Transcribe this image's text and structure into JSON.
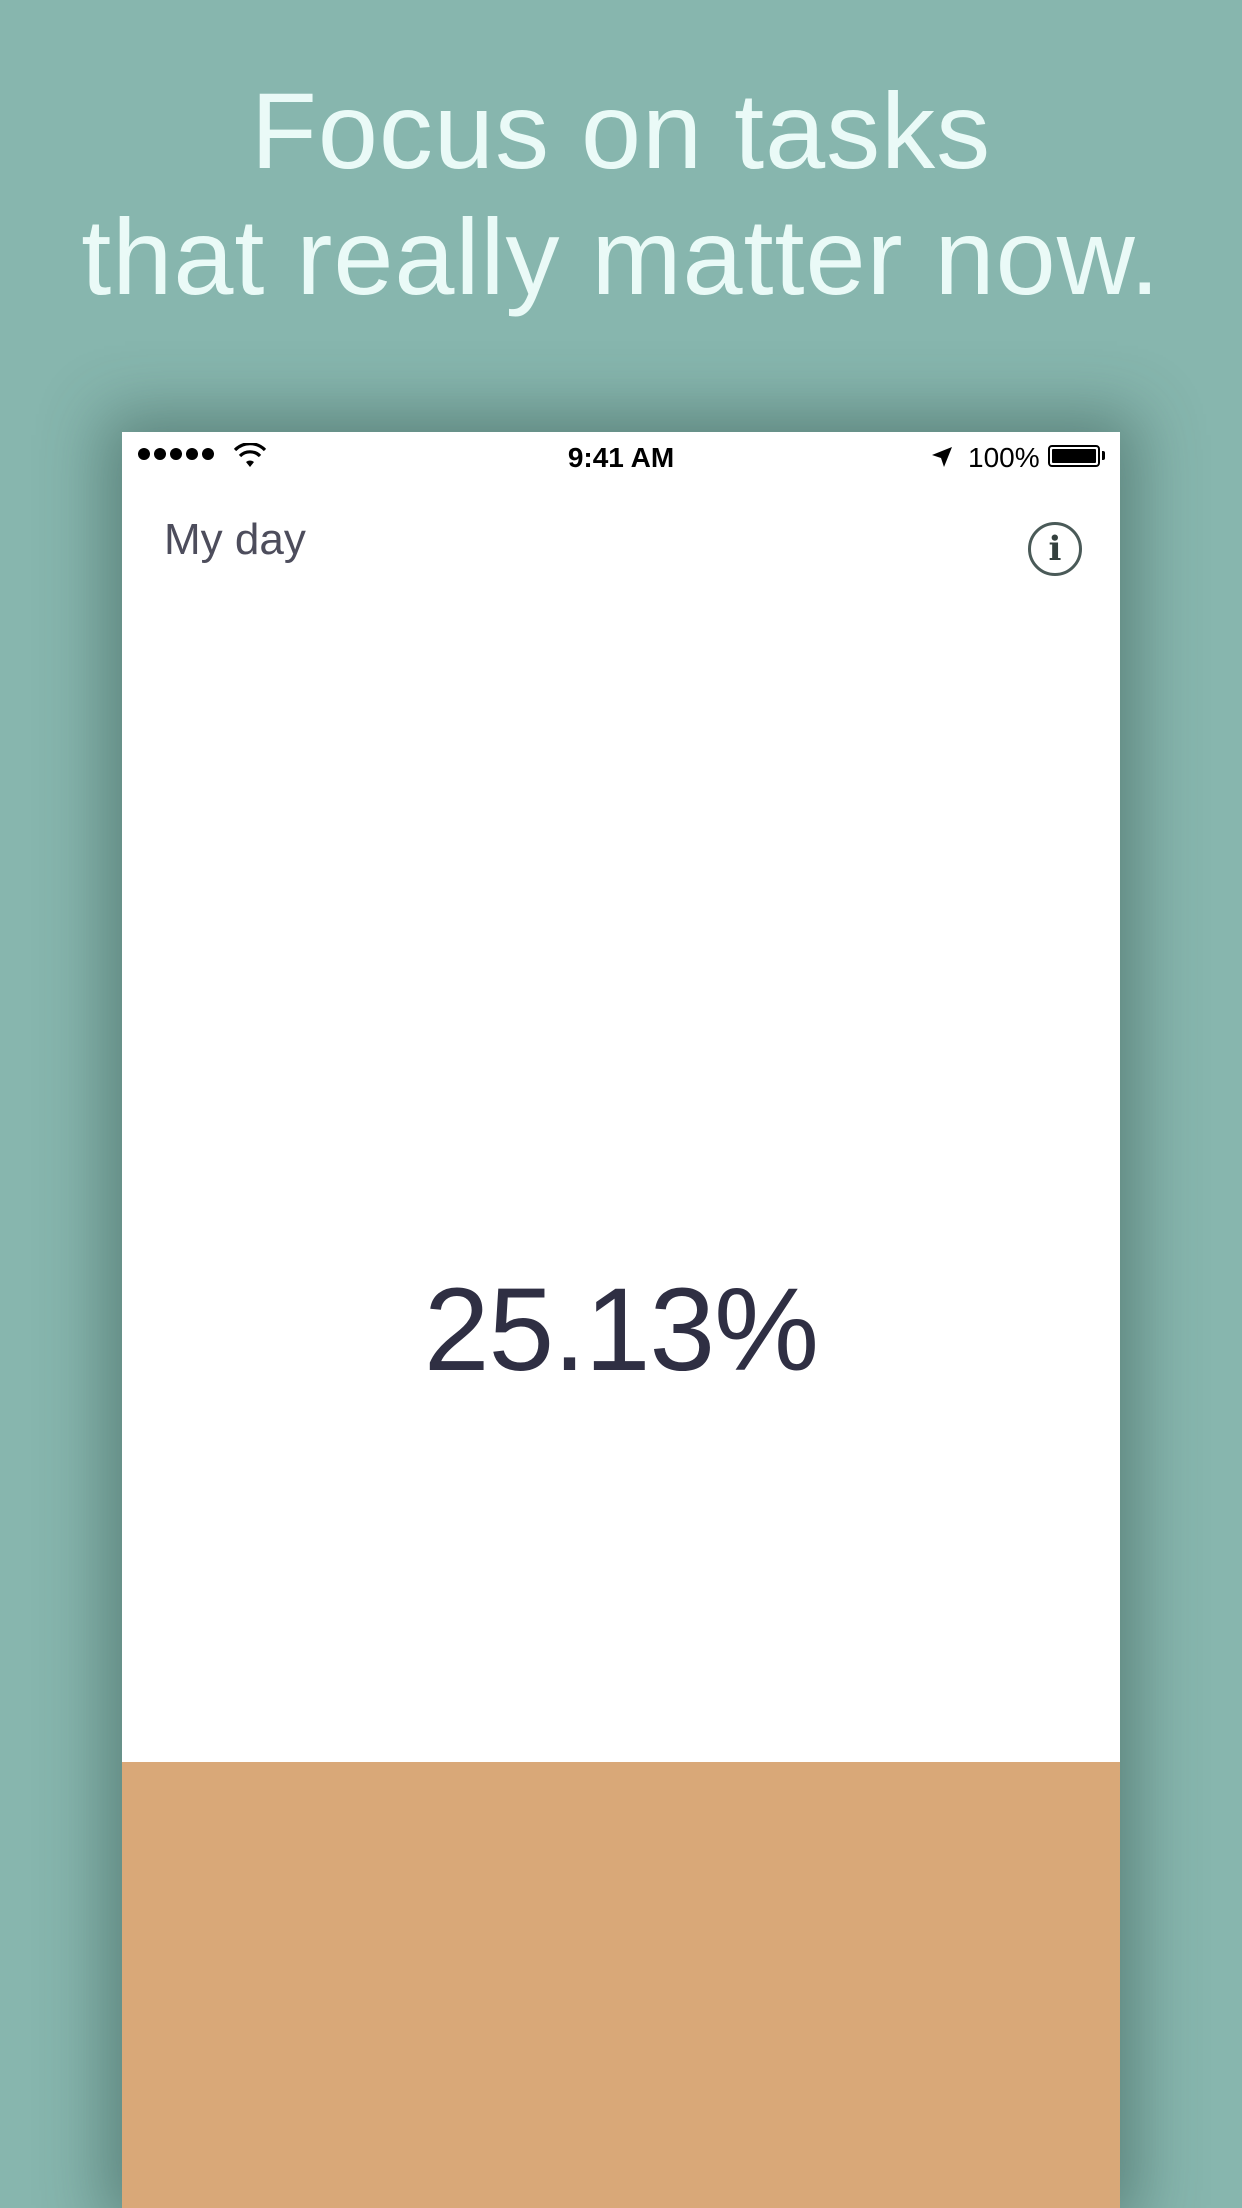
{
  "headline": {
    "line1": "Focus on tasks",
    "line2": "that really matter now."
  },
  "status_bar": {
    "time": "9:41 AM",
    "battery_percent": "100%",
    "signal_icon": "signal-dots-icon",
    "wifi_icon": "wifi-icon",
    "location_icon": "location-arrow-icon",
    "battery_icon": "battery-icon"
  },
  "nav": {
    "title": "My day",
    "info_icon": "info-icon",
    "info_glyph": "i"
  },
  "progress": {
    "label": "25.13%",
    "fraction": 0.2513
  },
  "colors": {
    "background": "#87b6ae",
    "headline_text": "#eafaf7",
    "progress_fill": "#d9a878",
    "percent_text": "#2f2f43"
  }
}
